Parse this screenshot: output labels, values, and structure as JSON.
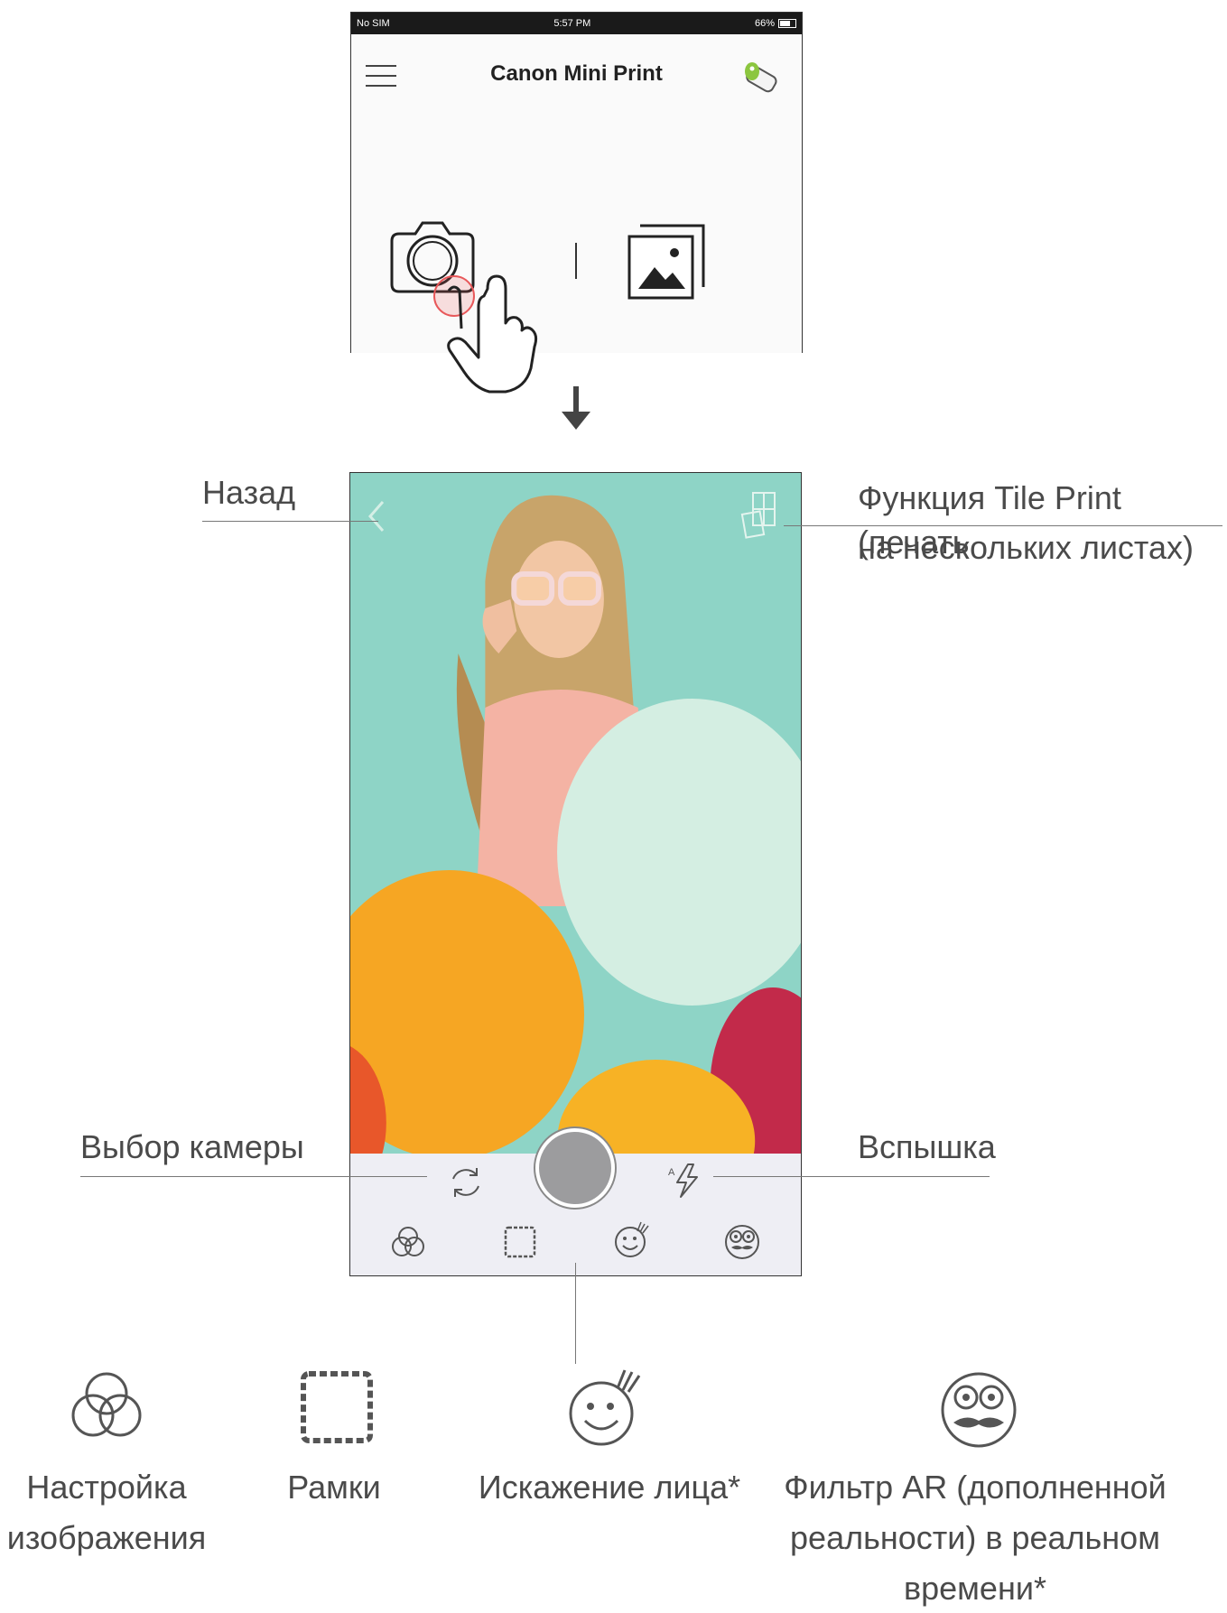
{
  "status_bar": {
    "carrier": "No SIM",
    "time": "5:57 PM",
    "battery": "66%"
  },
  "app": {
    "title": "Canon Mini Print"
  },
  "icons": {
    "menu": "menu-icon",
    "printer": "printer-icon",
    "camera": "camera-icon",
    "gallery": "gallery-icon",
    "hand": "tap-hand-icon",
    "arrow": "arrow-down-icon",
    "back": "back-chevron-icon",
    "tile": "tile-print-icon",
    "flip": "flip-camera-icon",
    "flash": "flash-auto-icon",
    "adjust": "image-adjust-icon",
    "frames": "frames-icon",
    "face": "face-warp-icon",
    "ar": "ar-filter-icon"
  },
  "annotations": {
    "back": "Назад",
    "tile_print_line1": "Функция Tile Print (печать",
    "tile_print_line2": "на нескольких листах)",
    "camera_select": "Выбор камеры",
    "flash": "Вспышка"
  },
  "features": [
    {
      "line1": "Настройка",
      "line2": "изображения",
      "line3": ""
    },
    {
      "line1": "Рамки",
      "line2": "",
      "line3": ""
    },
    {
      "line1": "Искажение лица*",
      "line2": "",
      "line3": ""
    },
    {
      "line1": "Фильтр AR (дополненной",
      "line2": "реальности) в реальном",
      "line3": "времени*"
    }
  ],
  "colors": {
    "tap_highlight": "#e8585a",
    "printer_led": "#8cc63f",
    "photo_background": "#8dd1c4",
    "balloon_yellow": "#f6a623",
    "balloon_mint": "#cfece0"
  }
}
